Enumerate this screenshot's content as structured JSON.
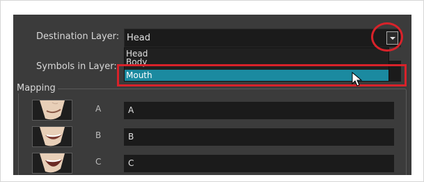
{
  "destination_layer": {
    "label": "Destination Layer:",
    "value": "Head",
    "options": [
      "Head",
      "Body",
      "Mouth"
    ],
    "selected_option": "Mouth"
  },
  "symbols_in_layer": {
    "label": "Symbols in Layer:"
  },
  "mapping": {
    "title": "Mapping",
    "rows": [
      {
        "letter": "A",
        "value": "A"
      },
      {
        "letter": "B",
        "value": "B"
      },
      {
        "letter": "C",
        "value": "C"
      }
    ]
  },
  "colors": {
    "panel": "#3b3b3b",
    "field": "#1b1b1b",
    "selection": "#1b8aa0",
    "annotation": "#d8222a"
  },
  "icons": {
    "dropdown_arrow": "chevron-down-icon",
    "cursor": "mouse-pointer-icon"
  }
}
